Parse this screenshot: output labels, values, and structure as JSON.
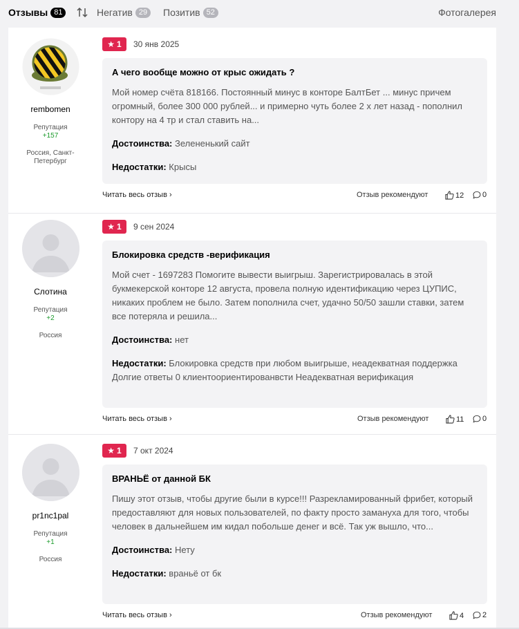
{
  "tabs": [
    {
      "label": "Отзывы",
      "count": "81"
    },
    {
      "label": "Негатив",
      "count": "29"
    },
    {
      "label": "Позитив",
      "count": "52"
    }
  ],
  "gallery_label": "Фотогалерея",
  "common": {
    "rep_label": "Репутация",
    "read_more": "Читать весь отзыв",
    "recommend_label": "Отзыв рекомендуют",
    "pros_label": "Достоинства:",
    "cons_label": "Недостатки:"
  },
  "reviews": [
    {
      "user": "rembomen",
      "reputation": "+157",
      "location": "Россия, Санкт-Петербург",
      "rating": "1",
      "date": "30 янв 2025",
      "title": "А чего вообще можно от крыс ожидать ?",
      "text": "Мой номер счёта 818166. Постоянный минус в конторе БалтБет ... минус причем огромный, более 300 000 рублей... и примерно чуть более 2 х лет назад - пополнил контору на 4 тр и стал ставить на...",
      "pros": "Зелененький сайт",
      "cons": "Крысы",
      "likes": "12",
      "comments": "0"
    },
    {
      "user": "Слотина",
      "reputation": "+2",
      "location": "Россия",
      "rating": "1",
      "date": "9 сен 2024",
      "title": "Блокировка средств -верификация",
      "text": "Мой счет - 1697283 Помогите вывести выигрыш. Зарегистрировалась в этой букмекерской конторе 12 августа, провела полную идентификацию через ЦУПИС, никаких проблем не было. Затем пополнила счет, удачно 50/50 зашли ставки, затем все потеряла и решила...",
      "pros": "нет",
      "cons": "Блокировка средств при любом выигрыше, неадекватная поддержка Долгие ответы 0 клиентоориентированвсти Неадекватная верификация",
      "likes": "11",
      "comments": "0"
    },
    {
      "user": "pr1nc1pal",
      "reputation": "+1",
      "location": "Россия",
      "rating": "1",
      "date": "7 окт 2024",
      "title": "ВРАНЬЁ от данной БК",
      "text": "Пишу этот отзыв, чтобы другие были в курсе!!! Разрекламированный фрибет, который предоставляют для новых пользователей, по факту просто замануха для того, чтобы человек в дальнейшем им кидал побольше денег и всё. Так уж вышло, что...",
      "pros": "Нету",
      "cons": "враньё от бк",
      "likes": "4",
      "comments": "2"
    }
  ]
}
